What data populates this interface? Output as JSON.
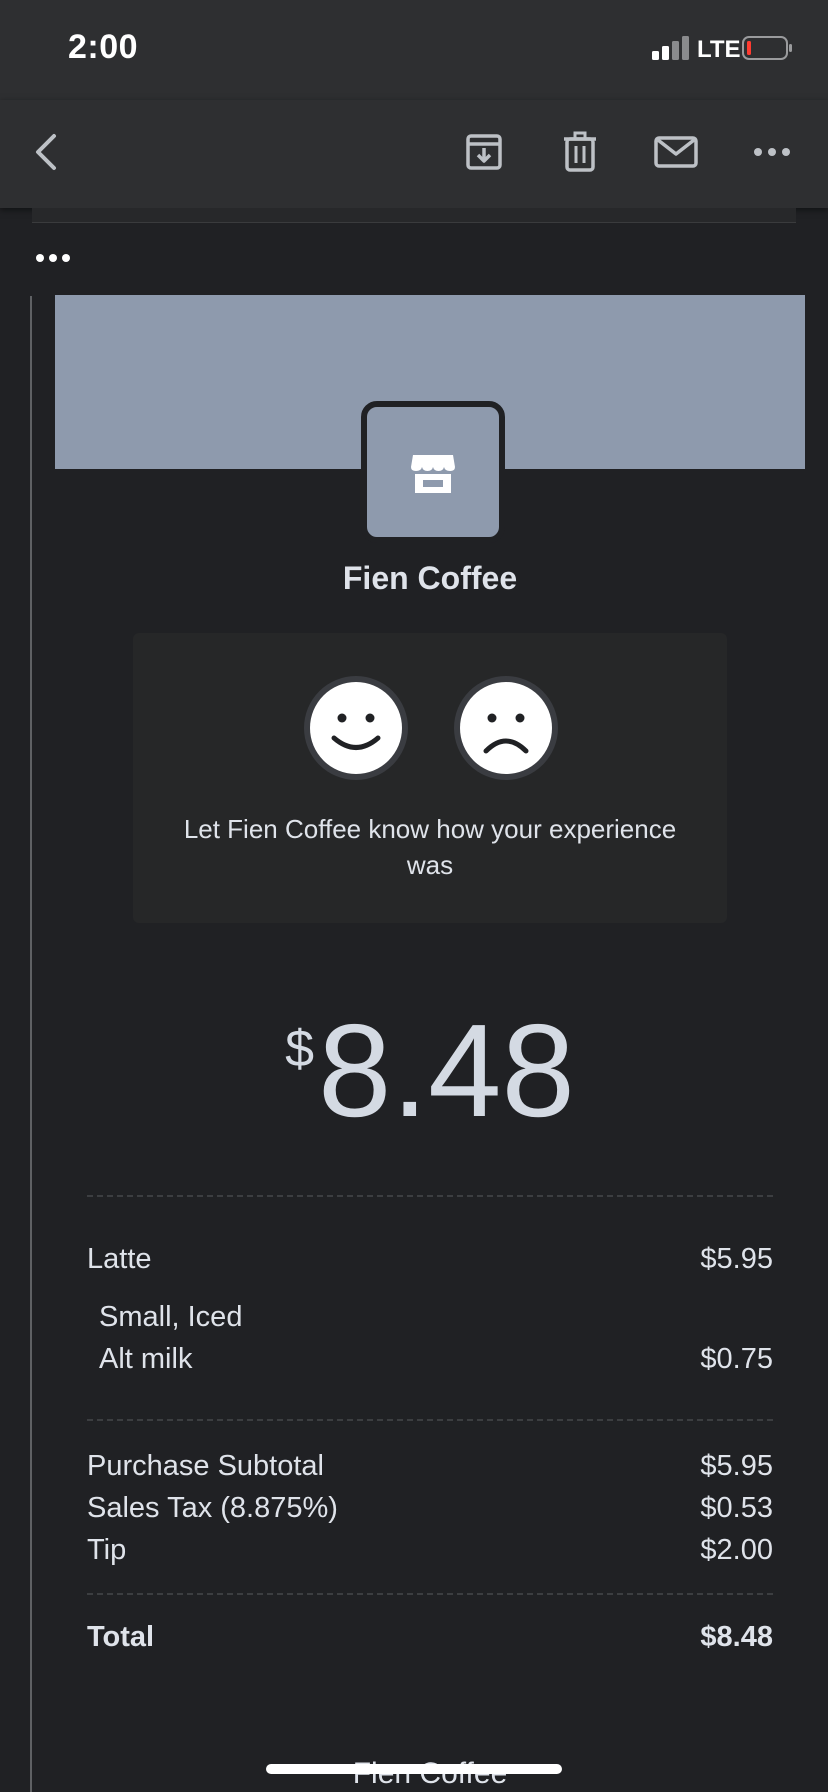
{
  "status_bar": {
    "time": "2:00",
    "network": "LTE"
  },
  "toolbar": {
    "back_icon": "chevron-left-icon",
    "actions": [
      "archive-icon",
      "trash-icon",
      "mail-icon",
      "more-horizontal-icon"
    ]
  },
  "thread": {
    "collapsed_indicator": "more-horizontal-icon"
  },
  "receipt": {
    "banner_color": "#8e9aad",
    "logo_icon": "storefront-icon",
    "merchant_name": "Fien Coffee",
    "feedback": {
      "positive_icon": "smiley-face-icon",
      "negative_icon": "frown-face-icon",
      "prompt": "Let Fien Coffee know how your experience was"
    },
    "amount": {
      "currency": "$",
      "value": "8.48"
    },
    "items": [
      {
        "label": "Latte",
        "price": "$5.95"
      },
      {
        "label": "Small, Iced",
        "price": ""
      },
      {
        "label": "Alt milk",
        "price": "$0.75"
      }
    ],
    "summary": [
      {
        "label": "Purchase Subtotal",
        "value": "$5.95"
      },
      {
        "label": "Sales Tax (8.875%)",
        "value": "$0.53"
      },
      {
        "label": "Tip",
        "value": "$2.00"
      }
    ],
    "total": {
      "label": "Total",
      "value": "$8.48"
    },
    "footer_name": "Fien Coffee"
  }
}
